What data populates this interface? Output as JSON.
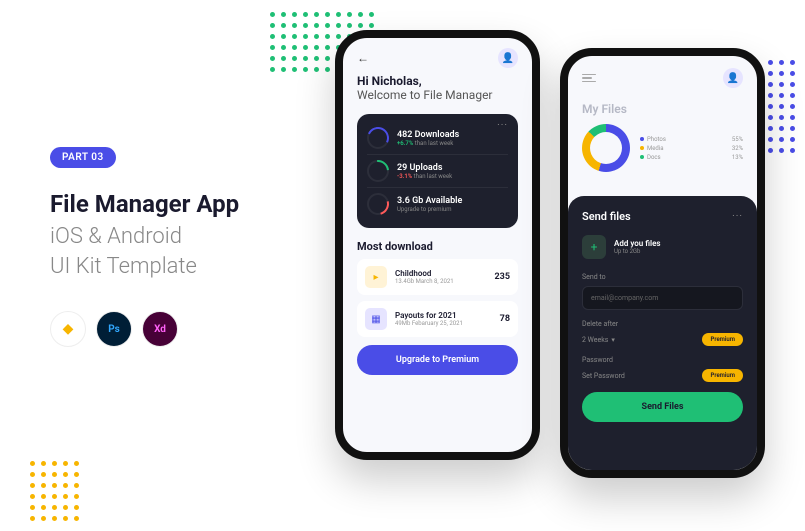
{
  "promo": {
    "badge": "PART 03",
    "title": "File Manager App",
    "subtitle1": "iOS & Android",
    "subtitle2": "UI Kit Template",
    "tools": {
      "sketch": "◆",
      "ps": "Ps",
      "xd": "Xd"
    }
  },
  "phone1": {
    "greeting": "Hi Nicholas,",
    "welcome": "Welcome to File Manager",
    "stats": [
      {
        "title": "482 Downloads",
        "delta": "+6.7%",
        "deltaClass": "",
        "suffix": " than last week"
      },
      {
        "title": "29 Uploads",
        "delta": "-3.1%",
        "deltaClass": "neg",
        "suffix": " than last week"
      },
      {
        "title": "3.6 Gb Available",
        "delta": "",
        "deltaClass": "",
        "suffix": "Upgrade to premium"
      }
    ],
    "section": "Most download",
    "files": [
      {
        "name": "Childhood",
        "meta": "13.4Gb March 8, 2021",
        "count": "235"
      },
      {
        "name": "Payouts for 2021",
        "meta": "49Mb Febaruary 25, 2021",
        "count": "78"
      }
    ],
    "cta": "Upgrade to Premium"
  },
  "phone2": {
    "header": "My Files",
    "legend": [
      {
        "label": "Photos",
        "val": "55%",
        "color": "#4a4de7"
      },
      {
        "label": "Media",
        "val": "32%",
        "color": "#f7b500"
      },
      {
        "label": "Docs",
        "val": "13%",
        "color": "#1fbf75"
      }
    ],
    "sheet": {
      "title": "Send files",
      "addTitle": "Add you files",
      "addSub": "Up to 2Gb",
      "sendToLabel": "Send to",
      "emailPlaceholder": "email@company.com",
      "deleteLabel": "Delete after",
      "deleteValue": "2 Weeks",
      "premium": "Premium",
      "passwordLabel": "Password",
      "passwordPlaceholder": "Set Password",
      "submit": "Send Files"
    }
  }
}
